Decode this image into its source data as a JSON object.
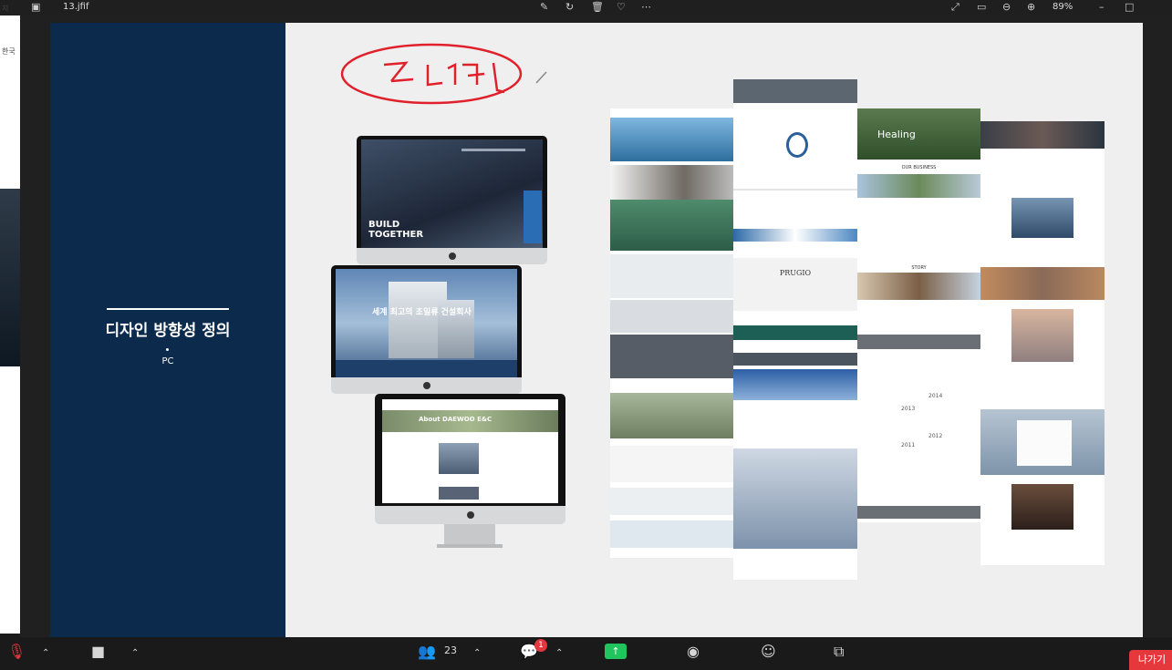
{
  "viewer": {
    "filename": "13.jfif",
    "zoom": "89%"
  },
  "leftstrip": {
    "t1": "지",
    "t2": "한국"
  },
  "slide": {
    "title": "디자인 방향성 정의",
    "subtitle": "PC",
    "screen1": {
      "headline1": "BUILD",
      "headline2": "TOGETHER"
    },
    "screen2": {
      "headline": "세계 최고의 초일류 건설회사"
    },
    "screen3": {
      "banner": "About DAEWOO E&C"
    },
    "col3": {
      "healing": "Healing",
      "business": "OUR BUSINESS",
      "story": "STORY",
      "year1": "2014",
      "year2": "2013",
      "year3": "2012",
      "year4": "2011"
    },
    "col2": {
      "prugio": "PRUGIO"
    }
  },
  "bottombar": {
    "participants_count": "23",
    "chat_badge": "1",
    "leave_label": "나가기"
  },
  "colors": {
    "navy": "#0c2a4c",
    "leave": "#e5383d",
    "share": "#21c55d",
    "annotation": "#e0202a"
  }
}
